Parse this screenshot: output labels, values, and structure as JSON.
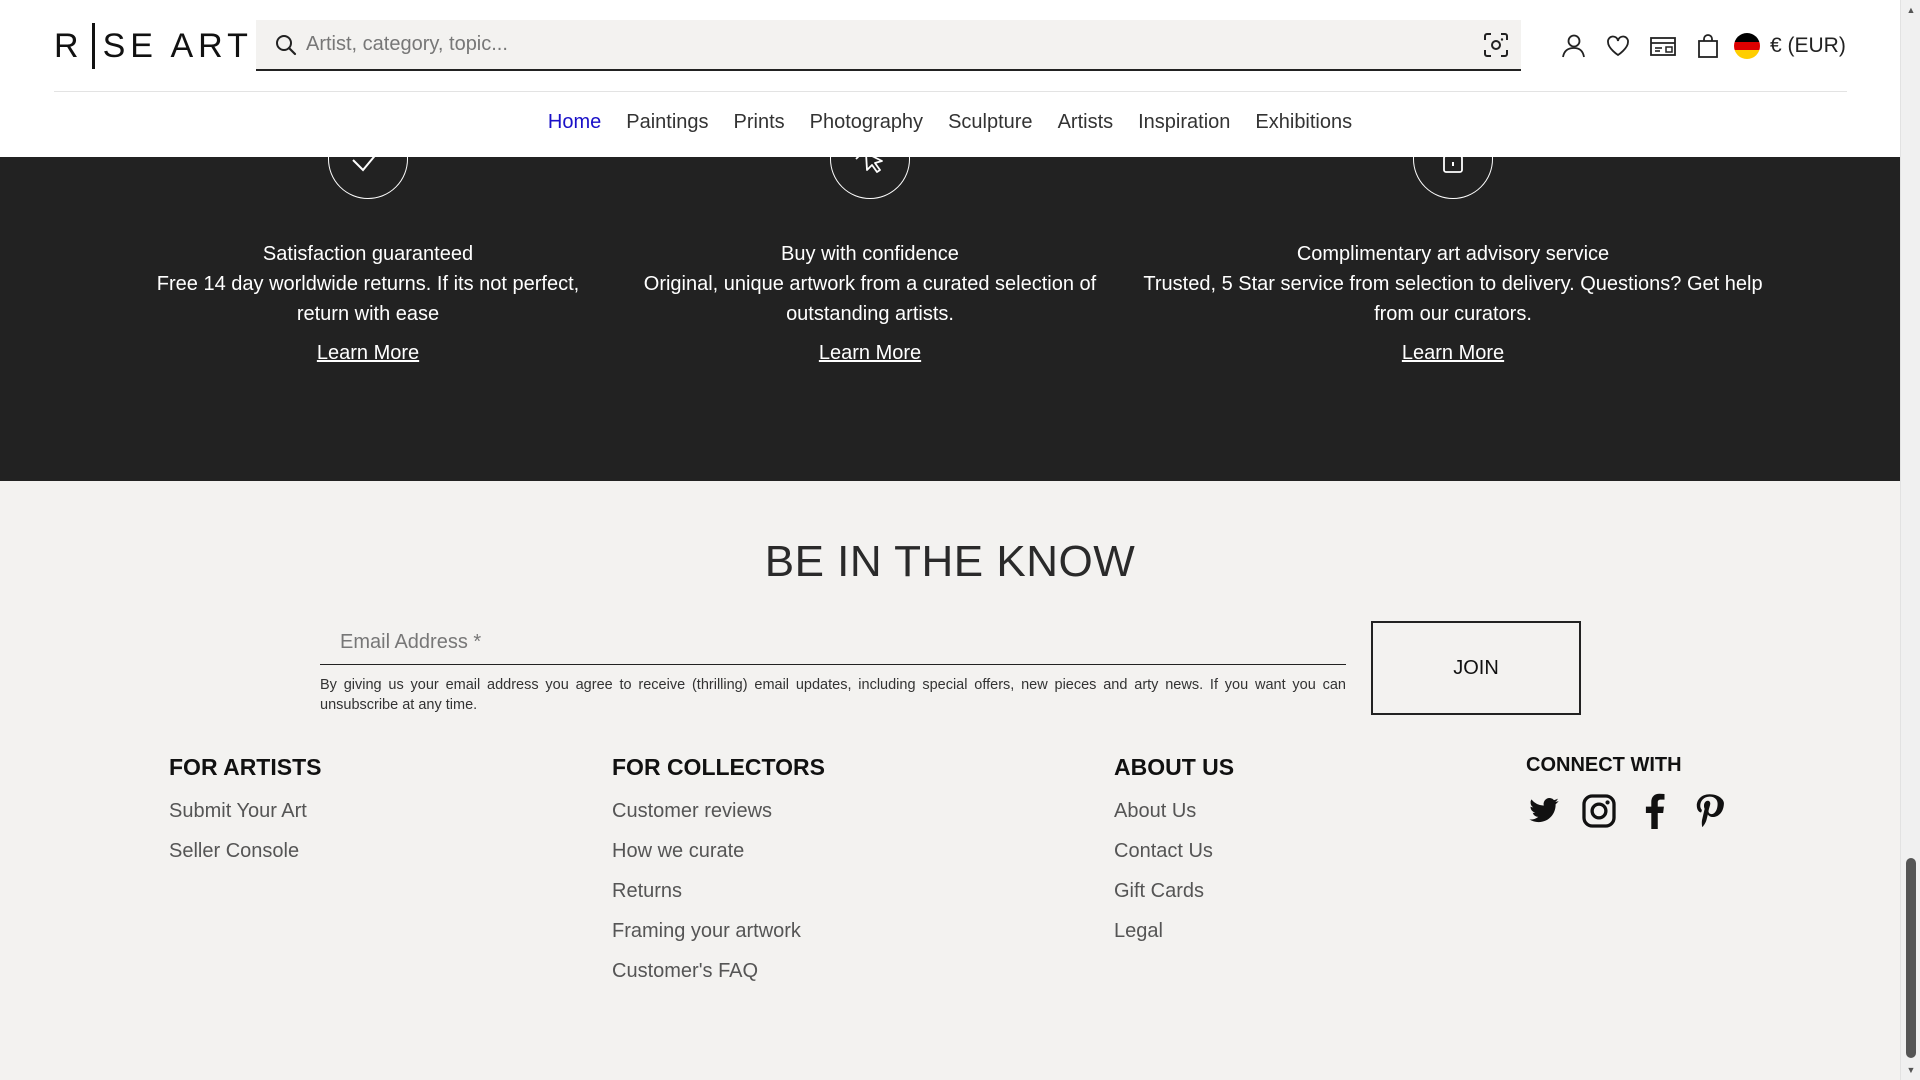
{
  "header": {
    "logo_left": "R",
    "logo_right": "SE ART",
    "search_placeholder": "Artist, category, topic...",
    "currency": "€ (EUR)"
  },
  "nav": {
    "items": [
      {
        "label": "Home",
        "active": true
      },
      {
        "label": "Paintings"
      },
      {
        "label": "Prints"
      },
      {
        "label": "Photography"
      },
      {
        "label": "Sculpture"
      },
      {
        "label": "Artists"
      },
      {
        "label": "Inspiration"
      },
      {
        "label": "Exhibitions"
      }
    ]
  },
  "features": [
    {
      "icon": "checkmark-icon",
      "title": "Satisfaction guaranteed",
      "desc": "Free 14 day worldwide returns. If its not perfect, return with ease",
      "link": "Learn More"
    },
    {
      "icon": "cursor-click-icon",
      "title": "Buy with confidence",
      "desc": "Original, unique artwork from a curated selection of outstanding artists.",
      "link": "Learn More"
    },
    {
      "icon": "lock-icon",
      "title": "Complimentary art advisory service",
      "desc": "Trusted, 5 Star service from selection to delivery. Questions? Get help from our curators.",
      "link": "Learn More"
    }
  ],
  "newsletter": {
    "heading": "BE IN THE KNOW",
    "email_placeholder": "Email Address *",
    "consent": "By giving us your email address you agree to receive (thrilling) email updates, including special offers, new pieces and arty news. If you want you can unsubscribe at any time.",
    "join_label": "JOIN"
  },
  "footer": {
    "artists": {
      "title": "FOR ARTISTS",
      "links": [
        "Submit Your Art",
        "Seller Console"
      ]
    },
    "collectors": {
      "title": "FOR COLLECTORS",
      "links": [
        "Customer reviews",
        "How we curate",
        "Returns",
        "Framing your artwork",
        "Customer's FAQ"
      ]
    },
    "about": {
      "title": "ABOUT US",
      "links": [
        "About Us",
        "Contact Us",
        "Gift Cards",
        "Legal"
      ]
    },
    "connect": {
      "title": "CONNECT WITH",
      "icons": [
        "twitter-icon",
        "instagram-icon",
        "facebook-icon",
        "pinterest-icon"
      ]
    }
  },
  "colors": {
    "band": "#222222",
    "background": "#f3f2f0",
    "nav_active": "#1a10c8"
  }
}
